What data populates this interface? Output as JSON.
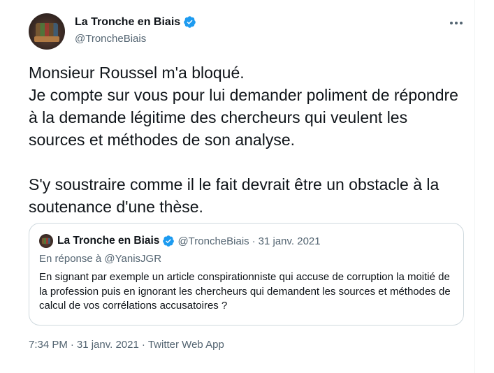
{
  "author": {
    "name": "La Tronche en Biais",
    "handle": "@TroncheBiais",
    "verified": true
  },
  "tweet": {
    "text": "Monsieur Roussel m'a bloqué.\nJe compte sur vous pour lui demander poliment de répondre à la demande légitime des chercheurs qui veulent les sources et méthodes de son analyse.\n\nS'y soustraire comme il le fait devrait être un obstacle à la soutenance d'une thèse."
  },
  "quoted": {
    "name": "La Tronche en Biais",
    "handle": "@TroncheBiais",
    "separator": "·",
    "date": "31 janv. 2021",
    "reply_prefix": "En réponse à ",
    "reply_to": "@YanisJGR",
    "text": "En signant par exemple un article conspirationniste qui accuse de corruption la moitié de la profession puis en ignorant les chercheurs qui demandent les sources et méthodes de calcul de vos corrélations accusatoires ?"
  },
  "meta": {
    "time": "7:34 PM",
    "separator1": "·",
    "date": "31 janv. 2021",
    "separator2": "·",
    "source": "Twitter Web App"
  },
  "icons": {
    "verified": "verified-badge-icon",
    "more": "more-options-icon"
  },
  "colors": {
    "verified": "#1d9bf0",
    "text": "#0f1419",
    "secondary": "#536471",
    "border": "#cfd9de"
  }
}
